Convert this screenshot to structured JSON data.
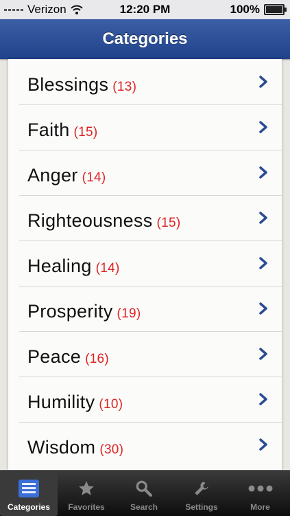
{
  "status": {
    "carrier": "Verizon",
    "time": "12:20 PM",
    "battery": "100%"
  },
  "nav": {
    "title": "Categories"
  },
  "categories": [
    {
      "name": "Blessings",
      "count": "(13)"
    },
    {
      "name": "Faith",
      "count": "(15)"
    },
    {
      "name": "Anger",
      "count": "(14)"
    },
    {
      "name": "Righteousness",
      "count": "(15)"
    },
    {
      "name": "Healing",
      "count": "(14)"
    },
    {
      "name": "Prosperity",
      "count": "(19)"
    },
    {
      "name": "Peace",
      "count": "(16)"
    },
    {
      "name": "Humility",
      "count": "(10)"
    },
    {
      "name": "Wisdom",
      "count": "(30)"
    }
  ],
  "tabs": [
    {
      "label": "Categories",
      "icon": "list-icon",
      "active": true
    },
    {
      "label": "Favorites",
      "icon": "star-icon",
      "active": false
    },
    {
      "label": "Search",
      "icon": "search-icon",
      "active": false
    },
    {
      "label": "Settings",
      "icon": "wrench-icon",
      "active": false
    },
    {
      "label": "More",
      "icon": "more-icon",
      "active": false
    }
  ],
  "colors": {
    "nav_blue": "#2d4e96",
    "count_red": "#d22222",
    "chevron_blue": "#2b4c93"
  }
}
